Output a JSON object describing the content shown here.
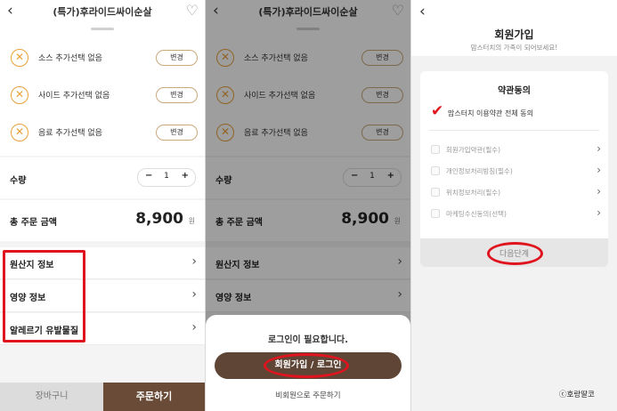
{
  "product_title": "(특가)후라이드싸이순살",
  "options": [
    {
      "label": "소스 추가선택 없음",
      "button": "변경"
    },
    {
      "label": "사이드 추가선택 없음",
      "button": "변경"
    },
    {
      "label": "음료 추가선택 없음",
      "button": "변경"
    }
  ],
  "quantity": {
    "label": "수량",
    "minus": "−",
    "value": "1",
    "plus": "+"
  },
  "total": {
    "label": "총 주문 금액",
    "amount": "8,900",
    "unit": "원"
  },
  "info_rows": [
    "원산지 정보",
    "영양 정보",
    "알레르기 유발물질"
  ],
  "bottom": {
    "cart": "장바구니",
    "order": "주문하기"
  },
  "modal": {
    "message": "로그인이 필요합니다.",
    "login_button": "회원가입 / 로그인",
    "guest_link": "비회원으로 주문하기"
  },
  "signup": {
    "title": "회원가입",
    "subtitle": "맘스터치의 가족이 되어보세요!",
    "terms_title": "약관동의",
    "agree_all": "맘스터치 이용약관 전체 동의",
    "terms": [
      "회원가입약관(필수)",
      "개인정보처리방침(필수)",
      "위치정보처리(필수)",
      "마케팅수신동의(선택)"
    ],
    "next_button": "다음단계"
  },
  "watermark": "ⓒ호랑딸코",
  "colors": {
    "accent_brown": "#6a4b38",
    "orange": "#e8a13a",
    "highlight_red": "#e0141e"
  }
}
